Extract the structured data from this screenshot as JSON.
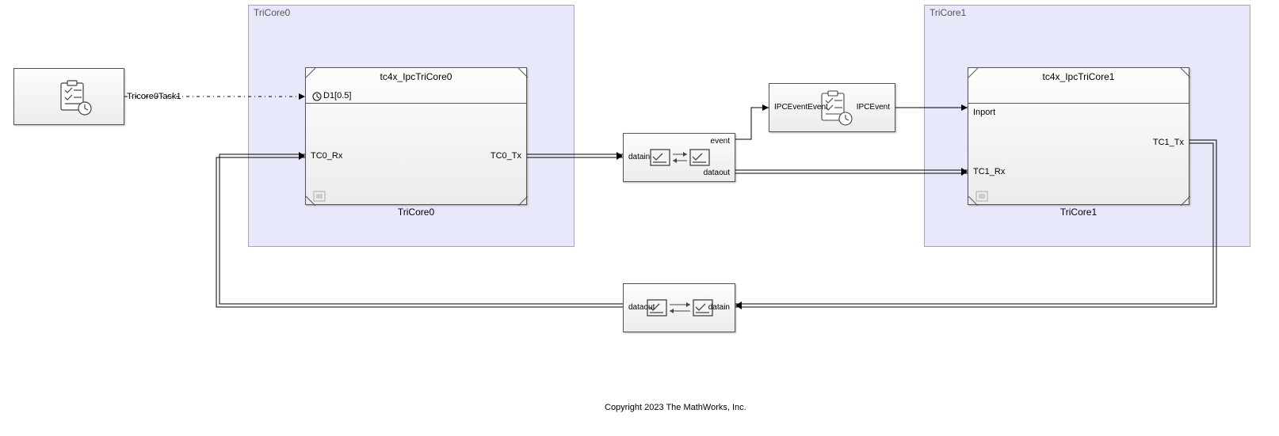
{
  "areas": {
    "tricore0": {
      "label": "TriCore0"
    },
    "tricore1": {
      "label": "TriCore1"
    }
  },
  "task_block": {
    "port": "Tricore0Task1"
  },
  "tricore0_block": {
    "title": "tc4x_IpcTriCore0",
    "trig": "D1[0.5]",
    "rx": "TC0_Rx",
    "tx": "TC0_Tx",
    "name": "TriCore0"
  },
  "tricore1_block": {
    "title": "tc4x_IpcTriCore1",
    "inport": "Inport",
    "rx": "TC1_Rx",
    "tx": "TC1_Tx",
    "name": "TriCore1"
  },
  "ipc_up": {
    "in": "datain",
    "out_ev": "event",
    "out_data": "dataout"
  },
  "ev_block": {
    "in": "IPCEventEvent",
    "out": "IPCEvent"
  },
  "ipc_down": {
    "in": "datain",
    "out": "dataout"
  },
  "footer": "Copyright 2023 The MathWorks, Inc."
}
